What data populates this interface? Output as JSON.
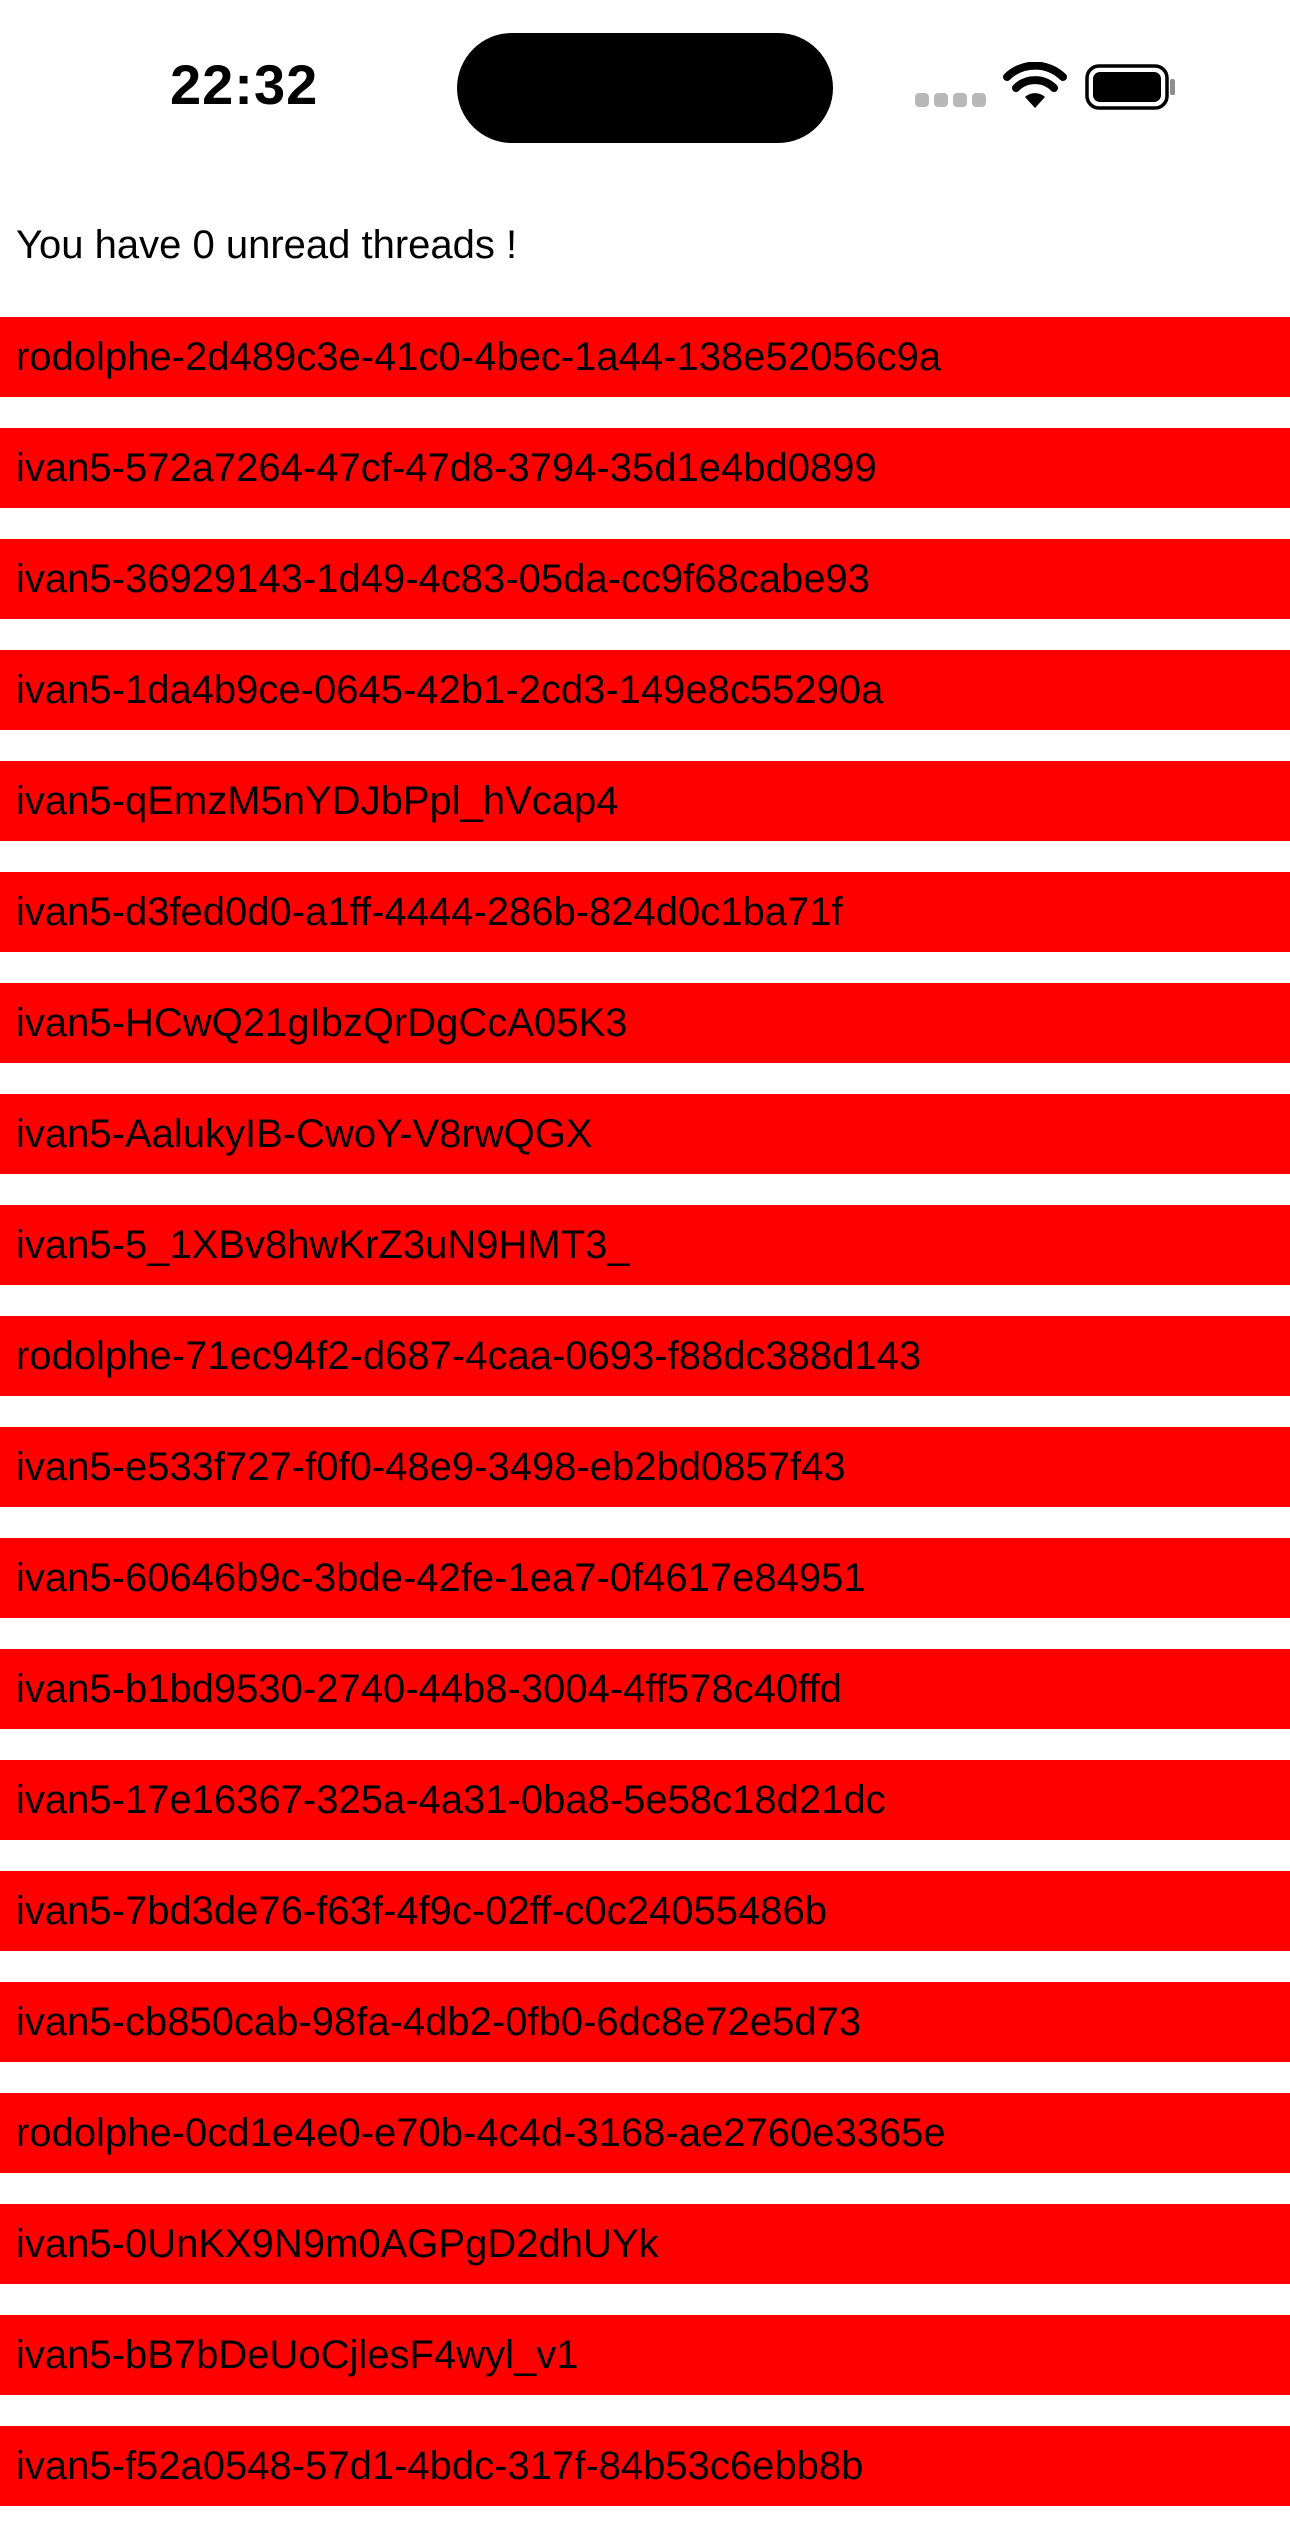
{
  "status_bar": {
    "time": "22:32",
    "icons": [
      "cellular-signal-icon",
      "wifi-icon",
      "battery-icon"
    ]
  },
  "header": {
    "text": "You have 0 unread threads !"
  },
  "colors": {
    "row_background": "#ff0000",
    "text": "#000000",
    "background": "#ffffff"
  },
  "threads": [
    "rodolphe-2d489c3e-41c0-4bec-1a44-138e52056c9a",
    "ivan5-572a7264-47cf-47d8-3794-35d1e4bd0899",
    "ivan5-36929143-1d49-4c83-05da-cc9f68cabe93",
    "ivan5-1da4b9ce-0645-42b1-2cd3-149e8c55290a",
    "ivan5-qEmzM5nYDJbPpl_hVcap4",
    "ivan5-d3fed0d0-a1ff-4444-286b-824d0c1ba71f",
    "ivan5-HCwQ21gIbzQrDgCcA05K3",
    "ivan5-AalukyIB-CwoY-V8rwQGX",
    "ivan5-5_1XBv8hwKrZ3uN9HMT3_",
    "rodolphe-71ec94f2-d687-4caa-0693-f88dc388d143",
    "ivan5-e533f727-f0f0-48e9-3498-eb2bd0857f43",
    "ivan5-60646b9c-3bde-42fe-1ea7-0f4617e84951",
    "ivan5-b1bd9530-2740-44b8-3004-4ff578c40ffd",
    "ivan5-17e16367-325a-4a31-0ba8-5e58c18d21dc",
    "ivan5-7bd3de76-f63f-4f9c-02ff-c0c24055486b",
    "ivan5-cb850cab-98fa-4db2-0fb0-6dc8e72e5d73",
    "rodolphe-0cd1e4e0-e70b-4c4d-3168-ae2760e3365e",
    "ivan5-0UnKX9N9m0AGPgD2dhUYk",
    "ivan5-bB7bDeUoCjlesF4wyl_v1",
    "ivan5-f52a0548-57d1-4bdc-317f-84b53c6ebb8b"
  ]
}
